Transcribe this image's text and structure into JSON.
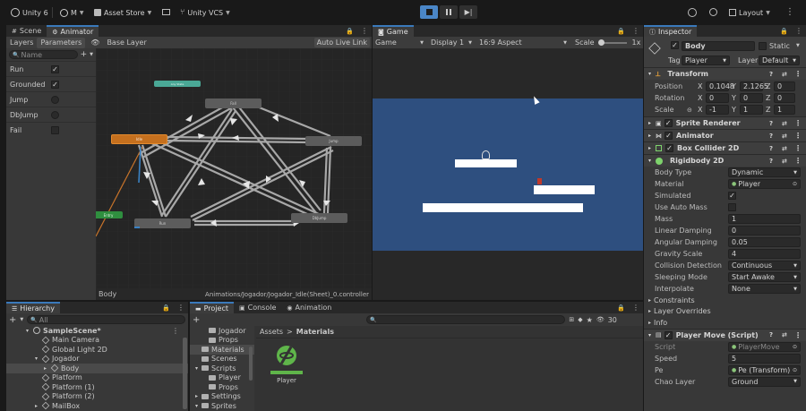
{
  "toolbar": {
    "unity_label": "Unity 6",
    "account_label": "M",
    "asset_store_label": "Asset Store",
    "vcs_label": "Unity VCS",
    "layout_label": "Layout"
  },
  "scene_tabs": {
    "scene": "Scene",
    "animator": "Animator"
  },
  "animator": {
    "layers_tab": "Layers",
    "parameters_tab": "Parameters",
    "base_layer": "Base Layer",
    "auto_live_link": "Auto Live Link",
    "search_placeholder": "Name",
    "params": [
      {
        "name": "Run",
        "type": "bool",
        "checked": true
      },
      {
        "name": "Grounded",
        "type": "bool",
        "checked": true
      },
      {
        "name": "Jump",
        "type": "trigger"
      },
      {
        "name": "DbJump",
        "type": "trigger"
      },
      {
        "name": "Fail",
        "type": "bool",
        "checked": false
      }
    ],
    "states": {
      "any": "Any State",
      "idle": "Idle",
      "fall": "Fall",
      "jump": "Jump",
      "run": "Run",
      "dbjump": "DbJump",
      "entry": "Entry"
    },
    "footer_left": "Body",
    "footer_right": "Animations/Jogador/Jogador_Idle(Sheet)_0.controller"
  },
  "game": {
    "tab": "Game",
    "mode": "Game",
    "display": "Display 1",
    "aspect": "16:9 Aspect",
    "scale_label": "Scale",
    "scale_value": "1x",
    "bg_color": "#2e4f7f"
  },
  "inspector": {
    "tab": "Inspector",
    "object_name": "Body",
    "static_label": "Static",
    "tag_label": "Tag",
    "tag_value": "Player",
    "layer_label": "Layer",
    "layer_value": "Default",
    "transform": {
      "title": "Transform",
      "position_label": "Position",
      "rotation_label": "Rotation",
      "scale_label": "Scale",
      "pos_x": "0.1048",
      "pos_y": "2.1265",
      "pos_z": "0",
      "rot_x": "0",
      "rot_y": "0",
      "rot_z": "0",
      "scl_x": "-1",
      "scl_y": "1",
      "scl_z": "1"
    },
    "sprite_renderer": "Sprite Renderer",
    "animator": "Animator",
    "box_collider": "Box Collider 2D",
    "rigidbody": {
      "title": "Rigidbody 2D",
      "rows": [
        {
          "label": "Body Type",
          "value": "Dynamic",
          "kind": "dropdown"
        },
        {
          "label": "Material",
          "value": "Player",
          "kind": "object"
        },
        {
          "label": "Simulated",
          "value": "",
          "kind": "check-on"
        },
        {
          "label": "Use Auto Mass",
          "value": "",
          "kind": "check-off"
        },
        {
          "label": "Mass",
          "value": "1",
          "kind": "field"
        },
        {
          "label": "Linear Damping",
          "value": "0",
          "kind": "field"
        },
        {
          "label": "Angular Damping",
          "value": "0.05",
          "kind": "field"
        },
        {
          "label": "Gravity Scale",
          "value": "4",
          "kind": "field"
        },
        {
          "label": "Collision Detection",
          "value": "Continuous",
          "kind": "dropdown"
        },
        {
          "label": "Sleeping Mode",
          "value": "Start Awake",
          "kind": "dropdown"
        },
        {
          "label": "Interpolate",
          "value": "None",
          "kind": "dropdown"
        }
      ],
      "foldouts": [
        "Constraints",
        "Layer Overrides",
        "Info"
      ]
    },
    "player_move": {
      "title": "Player Move (Script)",
      "rows": [
        {
          "label": "Script",
          "value": "PlayerMove",
          "kind": "object"
        },
        {
          "label": "Speed",
          "value": "5",
          "kind": "field"
        },
        {
          "label": "Pe",
          "value": "Pe (Transform)",
          "kind": "object"
        },
        {
          "label": "Chao Layer",
          "value": "Ground",
          "kind": "dropdown"
        }
      ]
    }
  },
  "hierarchy": {
    "tab": "Hierarchy",
    "search_placeholder": "All",
    "items": [
      {
        "label": "SampleScene*",
        "indent": 0,
        "bold": true,
        "arrow": "▾",
        "icon": "unity-icon"
      },
      {
        "label": "Main Camera",
        "indent": 1,
        "arrow": "",
        "icon": "cube-icon"
      },
      {
        "label": "Global Light 2D",
        "indent": 1,
        "arrow": "",
        "icon": "cube-icon"
      },
      {
        "label": "Jogador",
        "indent": 1,
        "arrow": "▾",
        "icon": "cube-icon"
      },
      {
        "label": "Body",
        "indent": 2,
        "arrow": "▸",
        "icon": "cube-icon",
        "selected": true
      },
      {
        "label": "Platform",
        "indent": 1,
        "arrow": "",
        "icon": "cube-icon"
      },
      {
        "label": "Platform (1)",
        "indent": 1,
        "arrow": "",
        "icon": "cube-icon"
      },
      {
        "label": "Platform (2)",
        "indent": 1,
        "arrow": "",
        "icon": "cube-icon"
      },
      {
        "label": "MailBox",
        "indent": 1,
        "arrow": "▸",
        "icon": "cube-icon"
      }
    ]
  },
  "project": {
    "project_tab": "Project",
    "console_tab": "Console",
    "animation_tab": "Animation",
    "hidden_count": "30",
    "breadcrumb_root": "Assets",
    "breadcrumb_sep": ">",
    "breadcrumb_leaf": "Materials",
    "folders": [
      {
        "label": "Jogador",
        "indent": 2,
        "arrow": ""
      },
      {
        "label": "Props",
        "indent": 2,
        "arrow": ""
      },
      {
        "label": "Materials",
        "indent": 1,
        "arrow": "",
        "selected": true
      },
      {
        "label": "Scenes",
        "indent": 1,
        "arrow": ""
      },
      {
        "label": "Scripts",
        "indent": 1,
        "arrow": "▾"
      },
      {
        "label": "Player",
        "indent": 2,
        "arrow": ""
      },
      {
        "label": "Props",
        "indent": 2,
        "arrow": ""
      },
      {
        "label": "Settings",
        "indent": 1,
        "arrow": "▸"
      },
      {
        "label": "Sprites",
        "indent": 1,
        "arrow": "▾"
      }
    ],
    "asset_label": "Player"
  }
}
